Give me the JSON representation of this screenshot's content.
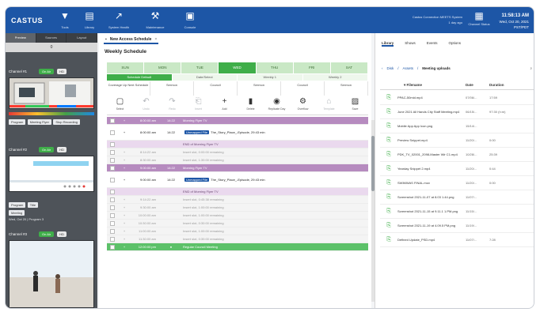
{
  "app": {
    "logo": "CASTUS"
  },
  "topbar": {
    "items": [
      {
        "icon": "filter-icon",
        "glyph": "▼",
        "label": "Tools"
      },
      {
        "icon": "folder-icon",
        "glyph": "▤",
        "label": "Library"
      },
      {
        "icon": "chart-icon",
        "glyph": "↗",
        "label": "System Health"
      },
      {
        "icon": "wrench-icon",
        "glyph": "⚒",
        "label": "Maintenance"
      },
      {
        "icon": "monitor-icon",
        "glyph": "▣",
        "label": "Console"
      }
    ],
    "status_line1": "Castus Connection MEETS System",
    "status_line2": "1 day ago",
    "schedule_label": "Channel Status",
    "clock_time": "11:58:13 AM",
    "clock_date1": "Wed, Oct 20, 2021",
    "clock_date2": "PST/PDT"
  },
  "left": {
    "tabs": [
      "Preview",
      "Sources",
      "Layout"
    ],
    "count": "0",
    "channels": [
      {
        "name": "Channel #1",
        "status": "On Air",
        "chips": [
          "Program",
          "Meeting Flyer",
          "Stop Recording"
        ],
        "meta": ""
      },
      {
        "name": "Channel #2",
        "status": "On Air",
        "chips": [
          "Program",
          "Title",
          "Meeting"
        ],
        "meta": "Wed, Oct 20 | Program 3"
      },
      {
        "name": "Channel #3",
        "status": "On Air",
        "chips": [],
        "meta": ""
      }
    ]
  },
  "middle": {
    "doc_tab": "New Access Schedule",
    "title": "Weekly Schedule",
    "days": [
      "SUN",
      "MON",
      "TUE",
      "WED",
      "THU",
      "FRI",
      "SAT"
    ],
    "day_headers": [
      "Schedule Default",
      "Date/Select",
      "Weekly 1",
      "Weekly 2"
    ],
    "columns": [
      "Coverage Up Next Schedule",
      "Sermon",
      "Council",
      "Sermon",
      "Council",
      "Sermon"
    ],
    "toolbar": [
      {
        "icon": "select-icon",
        "glyph": "▢",
        "label": "Select",
        "dim": false
      },
      {
        "icon": "undo-icon",
        "glyph": "↶",
        "label": "Undo",
        "dim": true
      },
      {
        "icon": "redo-icon",
        "glyph": "↷",
        "label": "Redo",
        "dim": true
      },
      {
        "icon": "insert-icon",
        "glyph": "⎗",
        "label": "Insert",
        "dim": true
      },
      {
        "icon": "add-icon",
        "glyph": "+",
        "label": "Add",
        "dim": false
      },
      {
        "icon": "delete-icon",
        "glyph": "▮",
        "label": "Delete",
        "dim": false
      },
      {
        "icon": "replicate-icon",
        "glyph": "◉",
        "label": "Replicate Day",
        "dim": false
      },
      {
        "icon": "overflow-icon",
        "glyph": "⚙",
        "label": "Overflow",
        "dim": false
      },
      {
        "icon": "template-icon",
        "glyph": "⌂",
        "label": "Template",
        "dim": true
      },
      {
        "icon": "save-icon",
        "glyph": "▨",
        "label": "Save",
        "dim": false
      }
    ],
    "rows": [
      {
        "kind": "purple",
        "mark": "+",
        "time": "8:00:00 am",
        "dur": "14:22",
        "text": "Morning Flyer TV"
      },
      {
        "kind": "tall",
        "mark": "+",
        "time": "8:00:00 am",
        "dur": "14:22",
        "badge": "Unmapped File",
        "text": "The_Story_Place_-Episode, 29:43 min"
      },
      {
        "kind": "lilac",
        "mark": "",
        "time": "",
        "dur": "",
        "text": "END of Morning Flyer TV"
      },
      {
        "kind": "grey",
        "mark": "+",
        "time": "8:14:22 am",
        "dur": "",
        "text": "Insert slot, 0:00:00 remaining"
      },
      {
        "kind": "grey",
        "mark": "+",
        "time": "8:30:00 am",
        "dur": "",
        "text": "Insert slot, 1:30:00 remaining"
      },
      {
        "kind": "purple",
        "mark": "+",
        "time": "9:00:00 am",
        "dur": "14:22",
        "text": "Morning Flyer TV"
      },
      {
        "kind": "tall",
        "mark": "+",
        "time": "9:00:00 am",
        "dur": "14:22",
        "badge": "Unmapped File",
        "text": "The_Story_Place_-Episode, 29:43 min"
      },
      {
        "kind": "lilac",
        "mark": "",
        "time": "",
        "dur": "",
        "text": "END of Morning Flyer TV"
      },
      {
        "kind": "grey",
        "mark": "+",
        "time": "9:14:22 am",
        "dur": "",
        "text": "Insert slot, 0:45:38 remaining"
      },
      {
        "kind": "grey",
        "mark": "+",
        "time": "9:30:00 am",
        "dur": "",
        "text": "Insert slot, 1:00:00 remaining"
      },
      {
        "kind": "grey",
        "mark": "+",
        "time": "10:00:00 am",
        "dur": "",
        "text": "Insert slot, 1:00:00 remaining"
      },
      {
        "kind": "grey",
        "mark": "+",
        "time": "10:30:00 am",
        "dur": "",
        "text": "Insert slot, 0:30:00 remaining"
      },
      {
        "kind": "grey",
        "mark": "+",
        "time": "11:00:00 am",
        "dur": "",
        "text": "Insert slot, 1:00:00 remaining"
      },
      {
        "kind": "grey",
        "mark": "+",
        "time": "11:30:00 am",
        "dur": "",
        "text": "Insert slot, 0:30:00 remaining"
      },
      {
        "kind": "green",
        "mark": "+",
        "time": "12:00:00 pm",
        "dur": "●",
        "text": "Regular Council Meeting"
      }
    ]
  },
  "right": {
    "tabs": [
      "Library",
      "Shows",
      "Events",
      "Options"
    ],
    "breadcrumb": [
      "Disk",
      "Assets"
    ],
    "current_folder": "Meeting uploads",
    "columns": [
      "Filename",
      "Date",
      "Duration"
    ],
    "files": [
      {
        "name": "PPAC-50mid.mp4",
        "date": "07/06/...",
        "dur": "17:59"
      },
      {
        "name": "June 2021 All Hands City Staff Meeting.mp4",
        "date": "06/15/...",
        "dur": "97:30 (h:m)"
      },
      {
        "name": "Mobile App App Icon.png",
        "date": "15/14/...",
        "dur": ""
      },
      {
        "name": "Preview Snippet.mp4",
        "date": "11/20/...",
        "dur": "0:00"
      },
      {
        "name": "PDK_TV_02001_2098-Master Wir C1.mp4",
        "date": "10/28/...",
        "dur": "25:39"
      },
      {
        "name": "Yearday Snippet 2.mp4",
        "date": "11/20/...",
        "dur": "0:44"
      },
      {
        "name": "SWIMWAS FINAL.mov",
        "date": "11/20/...",
        "dur": "0:00"
      },
      {
        "name": "Screenshot 2021-11-07 at 8.03 1.44.png",
        "date": "11/07/...",
        "dur": ""
      },
      {
        "name": "Screenshot 2021-11-15 at 9.11.1 1.PM.png",
        "date": "11/15/...",
        "dur": ""
      },
      {
        "name": "Screenshot 2021-11-19 at 4.09.5 PM.png",
        "date": "11/19/...",
        "dur": ""
      },
      {
        "name": "Defined Update_PSD.mp4",
        "date": "11/07/...",
        "dur": "7:28"
      }
    ]
  }
}
